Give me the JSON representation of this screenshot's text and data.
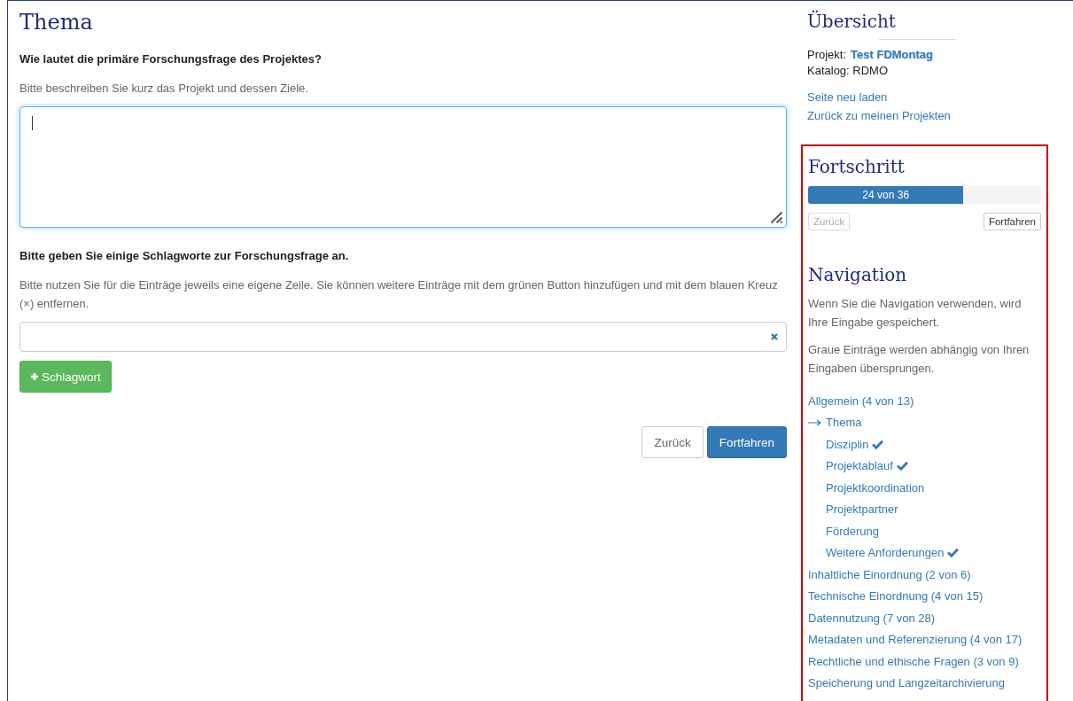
{
  "main": {
    "title": "Thema",
    "questions": [
      {
        "kind": "textarea",
        "label": "Wie lautet die primäre Forschungsfrage des Projektes?",
        "help": "Bitte beschreiben Sie kurz das Projekt und dessen Ziele.",
        "focused": true
      },
      {
        "kind": "list",
        "label": "Bitte geben Sie einige Schlagworte zur Forschungsfrage an.",
        "help": "Bitte nutzen Sie für die Einträge jeweils eine eigene Zeile. Sie können weitere Einträge mit dem grünen Button hinzufügen und mit dem blauen Kreuz (×) entfernen.",
        "add_button": "Schlagwort"
      }
    ],
    "buttons": [
      {
        "label": "Zurück",
        "kind": "default"
      },
      {
        "label": "Fortfahren",
        "kind": "primary"
      }
    ]
  },
  "sidebar": {
    "overview": {
      "title": "Übersicht",
      "project_label": "Projekt:",
      "project": "Test FDMontag",
      "catalog": "Katalog: RDMO",
      "links": [
        "Seite neu laden",
        "Zurück zu meinen Projekten"
      ]
    },
    "progress": {
      "title": "Fortschritt",
      "level": 0.667,
      "reading": "24 von 36",
      "buttons": [
        {
          "label": "Zurück",
          "disabled": true
        },
        {
          "label": "Fortfahren",
          "disabled": false
        }
      ]
    },
    "navigation": {
      "title": "Navigation",
      "notes": [
        "Wenn Sie die Navigation verwenden, wird Ihre Eingabe gespeichert.",
        "Graue Einträge werden abhängig von Ihren Eingaben übersprungen."
      ],
      "items": [
        {
          "label": "Allgemein (4 von 13)",
          "current": false,
          "done": false,
          "children": [
            {
              "label": "Thema",
              "current": true,
              "done": false
            },
            {
              "label": "Disziplin",
              "current": false,
              "done": true
            },
            {
              "label": "Projektablauf",
              "current": false,
              "done": true
            },
            {
              "label": "Projektkoordination",
              "current": false,
              "done": false
            },
            {
              "label": "Projektpartner",
              "current": false,
              "done": false
            },
            {
              "label": "Förderung",
              "current": false,
              "done": false
            },
            {
              "label": "Weitere Anforderungen",
              "current": false,
              "done": true
            }
          ]
        },
        {
          "label": "Inhaltliche Einordnung (2 von 6)",
          "current": false,
          "done": false
        },
        {
          "label": "Technische Einordnung (4 von 15)",
          "current": false,
          "done": false
        },
        {
          "label": "Datennutzung (7 von 28)",
          "current": false,
          "done": false
        },
        {
          "label": "Metadaten und Referenzierung (4 von 17)",
          "current": false,
          "done": false
        },
        {
          "label": "Rechtliche und ethische Fragen (3 von 9)",
          "current": false,
          "done": false
        },
        {
          "label": "Speicherung und Langzeitarchivierung",
          "current": false,
          "done": false
        }
      ]
    }
  }
}
